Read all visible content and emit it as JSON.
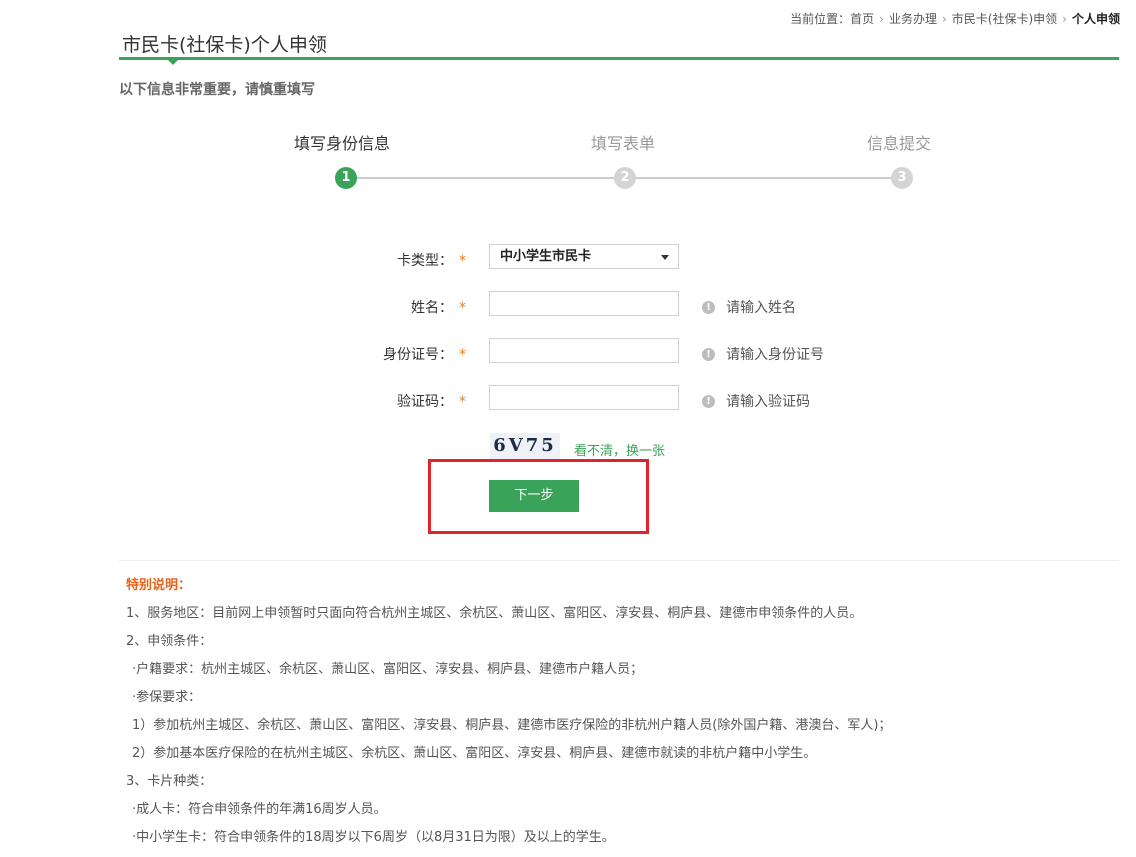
{
  "breadcrumb": {
    "prefix": "当前位置：",
    "items": [
      "首页",
      "业务办理",
      "市民卡(社保卡)申领"
    ],
    "current": "个人申领",
    "sep": "›"
  },
  "page": {
    "title": "市民卡(社保卡)个人申领",
    "subtitle": "以下信息非常重要，请慎重填写"
  },
  "steps": [
    {
      "label": "填写身份信息",
      "number": "1",
      "active": true
    },
    {
      "label": "填写表单",
      "number": "2",
      "active": false
    },
    {
      "label": "信息提交",
      "number": "3",
      "active": false
    }
  ],
  "form": {
    "required_mark": "*",
    "card_type": {
      "label": "卡类型：",
      "value": "中小学生市民卡"
    },
    "name": {
      "label": "姓名：",
      "value": "",
      "hint": "请输入姓名"
    },
    "id_number": {
      "label": "身份证号：",
      "value": "",
      "hint": "请输入身份证号"
    },
    "captcha": {
      "label": "验证码：",
      "value": "",
      "hint": "请输入验证码",
      "image_text": "6V75",
      "refresh_label": "看不清，换一张"
    },
    "hint_icon": "!",
    "next_button": "下一步"
  },
  "notes": {
    "title": "特别说明：",
    "lines": [
      "1、服务地区：目前网上申领暂时只面向符合杭州主城区、余杭区、萧山区、富阳区、淳安县、桐庐县、建德市申领条件的人员。",
      "2、申领条件：",
      "·户籍要求：杭州主城区、余杭区、萧山区、富阳区、淳安县、桐庐县、建德市户籍人员；",
      "·参保要求：",
      "1）参加杭州主城区、余杭区、萧山区、富阳区、淳安县、桐庐县、建德市医疗保险的非杭州户籍人员(除外国户籍、港澳台、军人)；",
      "2）参加基本医疗保险的在杭州主城区、余杭区、萧山区、富阳区、淳安县、桐庐县、建德市就读的非杭户籍中小学生。",
      "3、卡片种类：",
      "·成人卡：符合申领条件的年满16周岁人员。",
      "·中小学生卡：符合申领条件的18周岁以下6周岁（以8月31日为限）及以上的学生。"
    ]
  },
  "colors": {
    "accent": "#3aa35a",
    "highlight": "#e0242d",
    "note_title": "#e8631a"
  }
}
